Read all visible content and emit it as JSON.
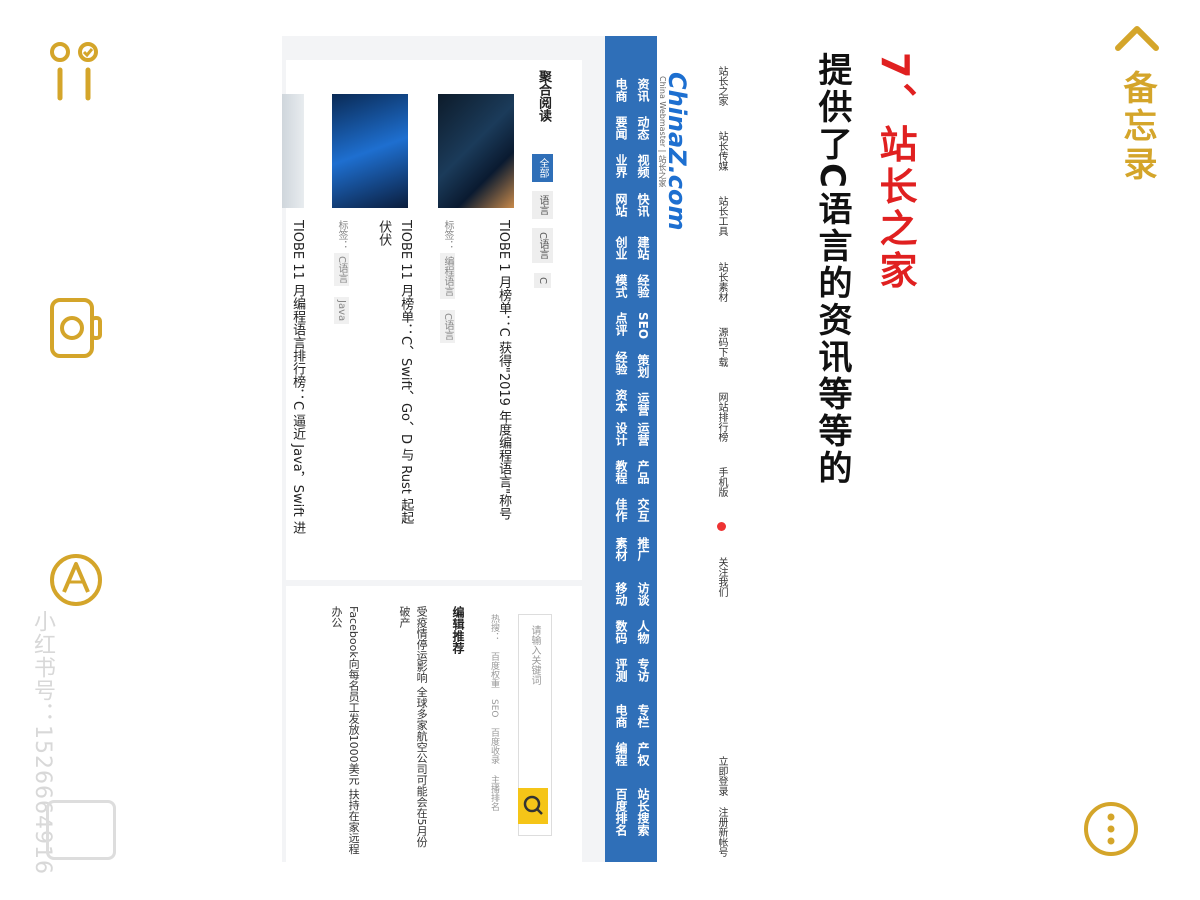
{
  "app": {
    "title": "备忘录",
    "left_toolbar": [
      {
        "icon": "checklist-icon"
      },
      {
        "icon": "camera-icon"
      },
      {
        "icon": "pen-icon"
      }
    ],
    "more_icon": "more-icon",
    "back_icon": "back-chevron-icon",
    "accent_color": "#d4a52a"
  },
  "note": {
    "heading": "7、站长之家",
    "subheading": "提供了C语言的资讯等等的"
  },
  "watermark": {
    "text": "小红书号：1526664916"
  },
  "site": {
    "top_links": [
      "站长之家",
      "站长传媒",
      "站长工具",
      "站长素材",
      "源码下载",
      "网站排行榜",
      "手机版",
      "关注我们"
    ],
    "top_right": [
      "立即登录",
      "注册新帐号"
    ],
    "logo": "ChinaZ.com",
    "logo_sub": "China Webmaster | 站长之家",
    "nav_columns": [
      [
        "资讯",
        "动态",
        "视频",
        "快讯"
      ],
      [
        "电商",
        "要闻",
        "业界",
        "网站"
      ],
      [
        "建站",
        "经验",
        "SEO",
        "策划",
        "运营"
      ],
      [
        "创业",
        "模式",
        "点评",
        "经验",
        "资本"
      ],
      [
        "运营",
        "产品",
        "交互",
        "推广"
      ],
      [
        "设计",
        "教程",
        "佳作",
        "素材"
      ],
      [
        "访谈",
        "人物",
        "专访"
      ],
      [
        "移动",
        "数码",
        "评测"
      ],
      [
        "专栏",
        "产权"
      ],
      [
        "电商",
        "编程"
      ],
      [
        "站长搜索",
        "百度排名"
      ]
    ],
    "section_title": "聚合阅读",
    "tabs": [
      "全部",
      "语言",
      "C语言",
      "C"
    ],
    "articles": [
      {
        "title": "TIOBE 1 月榜单：C 获得\"2019 年度编程语言\"称号",
        "tags_label": "标签：",
        "tags": [
          "编程语言",
          "C语言"
        ]
      },
      {
        "title": "TIOBE 11 月榜单：C、Swift、Go、D 与 Rust 起起伏伏",
        "tags_label": "标签：",
        "tags": [
          "C语言",
          "Java"
        ]
      },
      {
        "title": "TIOBE 11 月编程语言排行榜：C 逼近 Java，Swift 进",
        "tags_label": "",
        "tags": []
      }
    ],
    "search": {
      "placeholder": "请输入关键词",
      "hot_label": "热搜：",
      "hot": [
        "百度权重",
        "SEO",
        "百度收录",
        "主播排名"
      ]
    },
    "editor_pick_title": "编辑推荐",
    "news": [
      "受疫情停运影响 全球多家航空公司可能会在5月份破产",
      "Facebook向每名员工发放1000美元 扶持在家远程办公"
    ]
  }
}
